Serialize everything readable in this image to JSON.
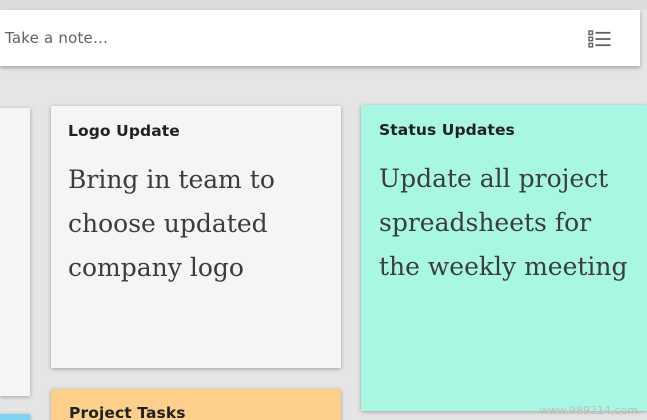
{
  "note_bar": {
    "placeholder": "Take a note…",
    "list_icon": "list-checkbox-icon"
  },
  "cards": [
    {
      "title": "Logo Update",
      "body": "Bring in team to choose updated company logo",
      "color": "#f5f5f5"
    },
    {
      "title": "Status Updates",
      "body": "Update all project spreadsheets for the weekly meeting",
      "color": "#a7f7e3"
    },
    {
      "title": "Project Tasks",
      "body": "",
      "color": "#fcd08a"
    }
  ],
  "watermark": "www.989214.com"
}
